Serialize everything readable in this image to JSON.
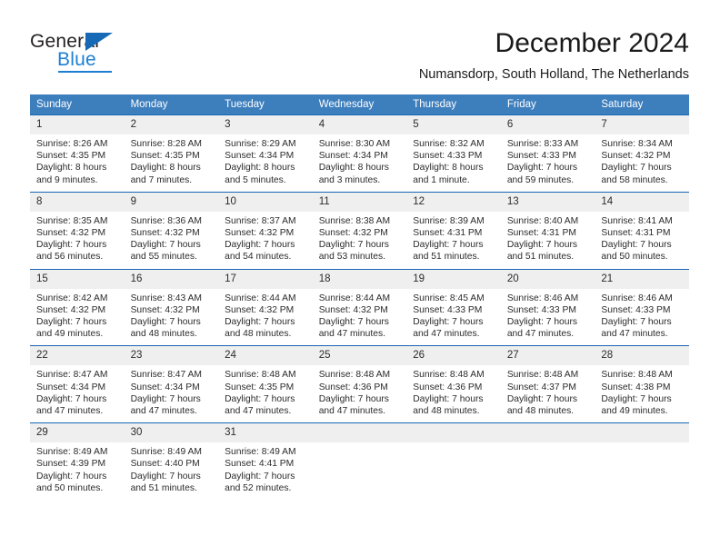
{
  "brand": {
    "name_part1": "General",
    "name_part2": "Blue",
    "triangle_icon": "triangle-icon",
    "accent_color": "#1c7fd4",
    "dark_color": "#231f20"
  },
  "header": {
    "title": "December 2024",
    "subtitle": "Numansdorp, South Holland, The Netherlands"
  },
  "calendar": {
    "header_bg": "#3d7ebd",
    "row_separator_color": "#1668b3",
    "daynum_bg": "#efefef",
    "weekdays": [
      "Sunday",
      "Monday",
      "Tuesday",
      "Wednesday",
      "Thursday",
      "Friday",
      "Saturday"
    ],
    "weeks": [
      [
        {
          "day": "1",
          "sunrise": "Sunrise: 8:26 AM",
          "sunset": "Sunset: 4:35 PM",
          "daylight": "Daylight: 8 hours and 9 minutes."
        },
        {
          "day": "2",
          "sunrise": "Sunrise: 8:28 AM",
          "sunset": "Sunset: 4:35 PM",
          "daylight": "Daylight: 8 hours and 7 minutes."
        },
        {
          "day": "3",
          "sunrise": "Sunrise: 8:29 AM",
          "sunset": "Sunset: 4:34 PM",
          "daylight": "Daylight: 8 hours and 5 minutes."
        },
        {
          "day": "4",
          "sunrise": "Sunrise: 8:30 AM",
          "sunset": "Sunset: 4:34 PM",
          "daylight": "Daylight: 8 hours and 3 minutes."
        },
        {
          "day": "5",
          "sunrise": "Sunrise: 8:32 AM",
          "sunset": "Sunset: 4:33 PM",
          "daylight": "Daylight: 8 hours and 1 minute."
        },
        {
          "day": "6",
          "sunrise": "Sunrise: 8:33 AM",
          "sunset": "Sunset: 4:33 PM",
          "daylight": "Daylight: 7 hours and 59 minutes."
        },
        {
          "day": "7",
          "sunrise": "Sunrise: 8:34 AM",
          "sunset": "Sunset: 4:32 PM",
          "daylight": "Daylight: 7 hours and 58 minutes."
        }
      ],
      [
        {
          "day": "8",
          "sunrise": "Sunrise: 8:35 AM",
          "sunset": "Sunset: 4:32 PM",
          "daylight": "Daylight: 7 hours and 56 minutes."
        },
        {
          "day": "9",
          "sunrise": "Sunrise: 8:36 AM",
          "sunset": "Sunset: 4:32 PM",
          "daylight": "Daylight: 7 hours and 55 minutes."
        },
        {
          "day": "10",
          "sunrise": "Sunrise: 8:37 AM",
          "sunset": "Sunset: 4:32 PM",
          "daylight": "Daylight: 7 hours and 54 minutes."
        },
        {
          "day": "11",
          "sunrise": "Sunrise: 8:38 AM",
          "sunset": "Sunset: 4:32 PM",
          "daylight": "Daylight: 7 hours and 53 minutes."
        },
        {
          "day": "12",
          "sunrise": "Sunrise: 8:39 AM",
          "sunset": "Sunset: 4:31 PM",
          "daylight": "Daylight: 7 hours and 51 minutes."
        },
        {
          "day": "13",
          "sunrise": "Sunrise: 8:40 AM",
          "sunset": "Sunset: 4:31 PM",
          "daylight": "Daylight: 7 hours and 51 minutes."
        },
        {
          "day": "14",
          "sunrise": "Sunrise: 8:41 AM",
          "sunset": "Sunset: 4:31 PM",
          "daylight": "Daylight: 7 hours and 50 minutes."
        }
      ],
      [
        {
          "day": "15",
          "sunrise": "Sunrise: 8:42 AM",
          "sunset": "Sunset: 4:32 PM",
          "daylight": "Daylight: 7 hours and 49 minutes."
        },
        {
          "day": "16",
          "sunrise": "Sunrise: 8:43 AM",
          "sunset": "Sunset: 4:32 PM",
          "daylight": "Daylight: 7 hours and 48 minutes."
        },
        {
          "day": "17",
          "sunrise": "Sunrise: 8:44 AM",
          "sunset": "Sunset: 4:32 PM",
          "daylight": "Daylight: 7 hours and 48 minutes."
        },
        {
          "day": "18",
          "sunrise": "Sunrise: 8:44 AM",
          "sunset": "Sunset: 4:32 PM",
          "daylight": "Daylight: 7 hours and 47 minutes."
        },
        {
          "day": "19",
          "sunrise": "Sunrise: 8:45 AM",
          "sunset": "Sunset: 4:33 PM",
          "daylight": "Daylight: 7 hours and 47 minutes."
        },
        {
          "day": "20",
          "sunrise": "Sunrise: 8:46 AM",
          "sunset": "Sunset: 4:33 PM",
          "daylight": "Daylight: 7 hours and 47 minutes."
        },
        {
          "day": "21",
          "sunrise": "Sunrise: 8:46 AM",
          "sunset": "Sunset: 4:33 PM",
          "daylight": "Daylight: 7 hours and 47 minutes."
        }
      ],
      [
        {
          "day": "22",
          "sunrise": "Sunrise: 8:47 AM",
          "sunset": "Sunset: 4:34 PM",
          "daylight": "Daylight: 7 hours and 47 minutes."
        },
        {
          "day": "23",
          "sunrise": "Sunrise: 8:47 AM",
          "sunset": "Sunset: 4:34 PM",
          "daylight": "Daylight: 7 hours and 47 minutes."
        },
        {
          "day": "24",
          "sunrise": "Sunrise: 8:48 AM",
          "sunset": "Sunset: 4:35 PM",
          "daylight": "Daylight: 7 hours and 47 minutes."
        },
        {
          "day": "25",
          "sunrise": "Sunrise: 8:48 AM",
          "sunset": "Sunset: 4:36 PM",
          "daylight": "Daylight: 7 hours and 47 minutes."
        },
        {
          "day": "26",
          "sunrise": "Sunrise: 8:48 AM",
          "sunset": "Sunset: 4:36 PM",
          "daylight": "Daylight: 7 hours and 48 minutes."
        },
        {
          "day": "27",
          "sunrise": "Sunrise: 8:48 AM",
          "sunset": "Sunset: 4:37 PM",
          "daylight": "Daylight: 7 hours and 48 minutes."
        },
        {
          "day": "28",
          "sunrise": "Sunrise: 8:48 AM",
          "sunset": "Sunset: 4:38 PM",
          "daylight": "Daylight: 7 hours and 49 minutes."
        }
      ],
      [
        {
          "day": "29",
          "sunrise": "Sunrise: 8:49 AM",
          "sunset": "Sunset: 4:39 PM",
          "daylight": "Daylight: 7 hours and 50 minutes."
        },
        {
          "day": "30",
          "sunrise": "Sunrise: 8:49 AM",
          "sunset": "Sunset: 4:40 PM",
          "daylight": "Daylight: 7 hours and 51 minutes."
        },
        {
          "day": "31",
          "sunrise": "Sunrise: 8:49 AM",
          "sunset": "Sunset: 4:41 PM",
          "daylight": "Daylight: 7 hours and 52 minutes."
        },
        {
          "day": "",
          "sunrise": "",
          "sunset": "",
          "daylight": ""
        },
        {
          "day": "",
          "sunrise": "",
          "sunset": "",
          "daylight": ""
        },
        {
          "day": "",
          "sunrise": "",
          "sunset": "",
          "daylight": ""
        },
        {
          "day": "",
          "sunrise": "",
          "sunset": "",
          "daylight": ""
        }
      ]
    ]
  }
}
